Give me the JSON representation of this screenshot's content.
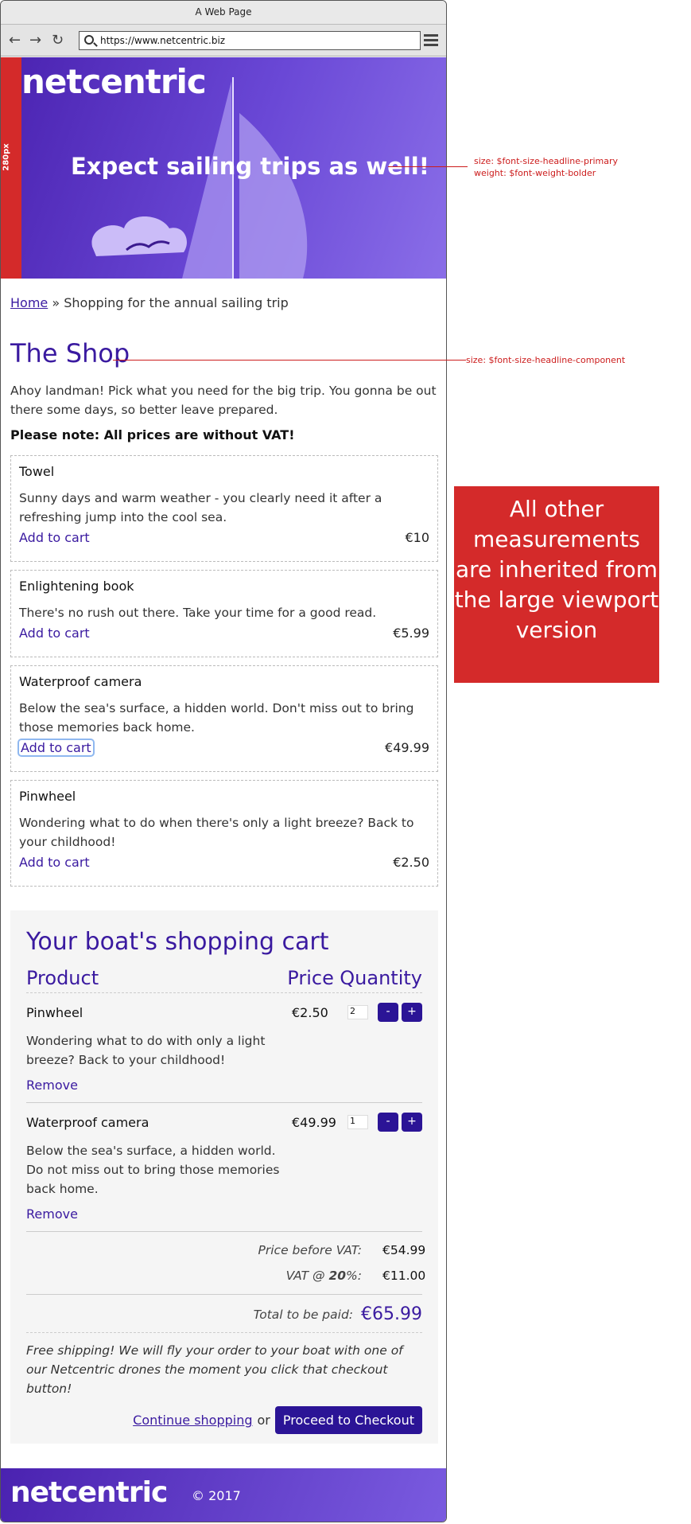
{
  "browser": {
    "title": "A Web Page",
    "url": "https://www.netcentric.biz"
  },
  "hero": {
    "logo": "netcentric",
    "headline": "Expect sailing trips as well!",
    "width_marker": "280px"
  },
  "breadcrumb": {
    "home": "Home",
    "separator": "»",
    "current": "Shopping for the annual sailing trip"
  },
  "shop": {
    "title": "The Shop",
    "intro": "Ahoy landman! Pick what you need for the big trip. You gonna be out there some days, so better leave prepared.",
    "vat_note": "Please note: All prices are without VAT!",
    "products": [
      {
        "name": "Towel",
        "desc": "Sunny days and warm weather - you clearly need it after a refreshing jump into the cool sea.",
        "add": "Add to cart",
        "price": "€10"
      },
      {
        "name": "Enlightening book",
        "desc": "There's no rush out there. Take your time for a good read.",
        "add": "Add to cart",
        "price": "€5.99"
      },
      {
        "name": "Waterproof camera",
        "desc": "Below the sea's surface, a hidden world. Don't miss out to bring those memories back home.",
        "add": "Add to cart",
        "price": "€49.99"
      },
      {
        "name": "Pinwheel",
        "desc": "Wondering what to do when there's only a light breeze? Back to your childhood!",
        "add": "Add to cart",
        "price": "€2.50"
      }
    ]
  },
  "cart": {
    "title": "Your boat's shopping cart",
    "headers": {
      "product": "Product",
      "price": "Price",
      "quantity": "Quantity"
    },
    "items": [
      {
        "name": "Pinwheel",
        "price": "€2.50",
        "qty": "2",
        "desc": "Wondering what to do with only a light breeze? Back to your childhood!",
        "remove": "Remove",
        "minus": "-",
        "plus": "+"
      },
      {
        "name": "Waterproof camera",
        "price": "€49.99",
        "qty": "1",
        "desc": "Below the sea's surface, a hidden world. Do not miss out to bring those memories back home.",
        "remove": "Remove",
        "minus": "-",
        "plus": "+"
      }
    ],
    "price_before_vat_label": "Price before VAT:",
    "price_before_vat": "€54.99",
    "vat_label_pre": "VAT @ ",
    "vat_rate": "20",
    "vat_label_post": "%:",
    "vat": "€11.00",
    "total_label": "Total to be paid:",
    "total": "€65.99",
    "shipping": "Free shipping! We will fly your order to your boat with one of our Netcentric drones the moment you click that checkout button!",
    "continue": "Continue shopping",
    "or": "or",
    "checkout": "Proceed to Checkout"
  },
  "footer": {
    "logo": "netcentric",
    "copyright": "© 2017"
  },
  "annotations": {
    "headline_1": "size: $font-size-headline-primary",
    "headline_2": "weight: $font-weight-bolder",
    "shop_title": "size: $font-size-headline-component",
    "info": "All other measurements are inherited from the large viewport version"
  },
  "colors": {
    "brand": "#3a1aa0",
    "annotation": "#d42a2a"
  }
}
